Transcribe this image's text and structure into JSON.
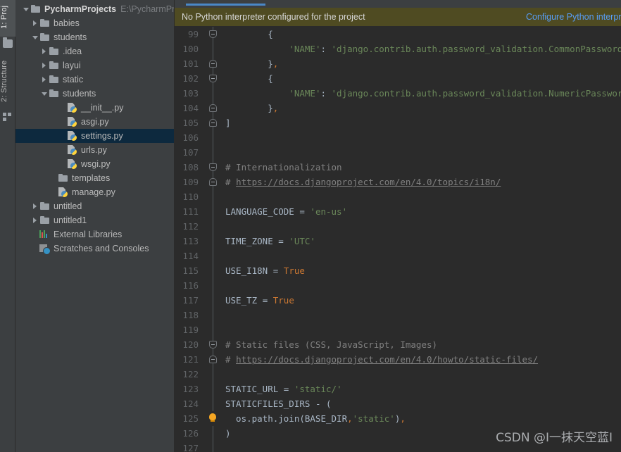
{
  "tool_strip": {
    "tabs": [
      {
        "label": "1: Proj",
        "name": "tool-tab-project",
        "active": true
      },
      {
        "label": "2: Structure",
        "name": "tool-tab-structure",
        "active": false
      }
    ]
  },
  "project_tree": {
    "root_label": "PycharmProjects",
    "root_path": "E:\\PycharmPro",
    "items": [
      {
        "label": "babies",
        "indent": 2,
        "arrow": "collapsed",
        "icon": "folder"
      },
      {
        "label": "students",
        "indent": 2,
        "arrow": "expanded",
        "icon": "folder"
      },
      {
        "label": ".idea",
        "indent": 3,
        "arrow": "collapsed",
        "icon": "folder"
      },
      {
        "label": "layui",
        "indent": 3,
        "arrow": "collapsed",
        "icon": "folder"
      },
      {
        "label": "static",
        "indent": 3,
        "arrow": "collapsed",
        "icon": "folder"
      },
      {
        "label": "students",
        "indent": 3,
        "arrow": "expanded",
        "icon": "folder"
      },
      {
        "label": "__init__.py",
        "indent": 5,
        "arrow": "none",
        "icon": "py"
      },
      {
        "label": "asgi.py",
        "indent": 5,
        "arrow": "none",
        "icon": "py"
      },
      {
        "label": "settings.py",
        "indent": 5,
        "arrow": "none",
        "icon": "py",
        "selected": true
      },
      {
        "label": "urls.py",
        "indent": 5,
        "arrow": "none",
        "icon": "py"
      },
      {
        "label": "wsgi.py",
        "indent": 5,
        "arrow": "none",
        "icon": "py"
      },
      {
        "label": "templates",
        "indent": 4,
        "arrow": "none",
        "icon": "folder"
      },
      {
        "label": "manage.py",
        "indent": 4,
        "arrow": "none",
        "icon": "py"
      },
      {
        "label": "untitled",
        "indent": 2,
        "arrow": "collapsed",
        "icon": "folder"
      },
      {
        "label": "untitled1",
        "indent": 2,
        "arrow": "collapsed",
        "icon": "folder"
      },
      {
        "label": "External Libraries",
        "indent": 2,
        "arrow": "none",
        "icon": "libs"
      },
      {
        "label": "Scratches and Consoles",
        "indent": 2,
        "arrow": "none",
        "icon": "scratch"
      }
    ]
  },
  "notification": {
    "message": "No Python interpreter configured for the project",
    "action_label": "Configure Python interpreter",
    "background": "#4f4b22",
    "link_color": "#589df6"
  },
  "editor": {
    "first_line": 99,
    "lines": [
      {
        "no": 99,
        "fold": "start",
        "tokens": [
          {
            "t": "        {",
            "c": "c-plain"
          }
        ]
      },
      {
        "no": 100,
        "fold": "bar",
        "tokens": [
          {
            "t": "            ",
            "c": "c-plain"
          },
          {
            "t": "'NAME'",
            "c": "c-str"
          },
          {
            "t": ": ",
            "c": "c-plain"
          },
          {
            "t": "'django.contrib.auth.password_validation.CommonPasswordValidator'",
            "c": "c-str"
          }
        ]
      },
      {
        "no": 101,
        "fold": "end",
        "tokens": [
          {
            "t": "        }",
            "c": "c-plain"
          },
          {
            "t": ",",
            "c": "c-comma"
          }
        ]
      },
      {
        "no": 102,
        "fold": "start",
        "tokens": [
          {
            "t": "        {",
            "c": "c-plain"
          }
        ]
      },
      {
        "no": 103,
        "fold": "bar",
        "tokens": [
          {
            "t": "            ",
            "c": "c-plain"
          },
          {
            "t": "'NAME'",
            "c": "c-str"
          },
          {
            "t": ": ",
            "c": "c-plain"
          },
          {
            "t": "'django.contrib.auth.password_validation.NumericPasswordValidator'",
            "c": "c-str"
          }
        ]
      },
      {
        "no": 104,
        "fold": "end",
        "tokens": [
          {
            "t": "        }",
            "c": "c-plain"
          },
          {
            "t": ",",
            "c": "c-comma"
          }
        ]
      },
      {
        "no": 105,
        "fold": "end",
        "tokens": [
          {
            "t": "]",
            "c": "c-plain"
          }
        ]
      },
      {
        "no": 106,
        "fold": "bar",
        "tokens": []
      },
      {
        "no": 107,
        "fold": "bar",
        "tokens": []
      },
      {
        "no": 108,
        "fold": "start",
        "tokens": [
          {
            "t": "# Internationalization",
            "c": "c-comment"
          }
        ]
      },
      {
        "no": 109,
        "fold": "end",
        "tokens": [
          {
            "t": "# ",
            "c": "c-comment"
          },
          {
            "t": "https://docs.djangoproject.com/en/4.0/topics/i18n/",
            "c": "c-link"
          }
        ]
      },
      {
        "no": 110,
        "fold": "bar",
        "tokens": []
      },
      {
        "no": 111,
        "fold": "bar",
        "tokens": [
          {
            "t": "LANGUAGE_CODE ",
            "c": "c-plain"
          },
          {
            "t": "= ",
            "c": "c-plain"
          },
          {
            "t": "'en-us'",
            "c": "c-str"
          }
        ]
      },
      {
        "no": 112,
        "fold": "bar",
        "tokens": []
      },
      {
        "no": 113,
        "fold": "bar",
        "tokens": [
          {
            "t": "TIME_ZONE ",
            "c": "c-plain"
          },
          {
            "t": "= ",
            "c": "c-plain"
          },
          {
            "t": "'UTC'",
            "c": "c-str"
          }
        ]
      },
      {
        "no": 114,
        "fold": "bar",
        "tokens": []
      },
      {
        "no": 115,
        "fold": "bar",
        "tokens": [
          {
            "t": "USE_I18N ",
            "c": "c-plain"
          },
          {
            "t": "= ",
            "c": "c-plain"
          },
          {
            "t": "True",
            "c": "c-kw"
          }
        ]
      },
      {
        "no": 116,
        "fold": "bar",
        "tokens": []
      },
      {
        "no": 117,
        "fold": "bar",
        "tokens": [
          {
            "t": "USE_TZ ",
            "c": "c-plain"
          },
          {
            "t": "= ",
            "c": "c-plain"
          },
          {
            "t": "True",
            "c": "c-kw"
          }
        ]
      },
      {
        "no": 118,
        "fold": "bar",
        "tokens": []
      },
      {
        "no": 119,
        "fold": "bar",
        "tokens": []
      },
      {
        "no": 120,
        "fold": "start",
        "tokens": [
          {
            "t": "# Static files (CSS, JavaScript, Images)",
            "c": "c-comment"
          }
        ]
      },
      {
        "no": 121,
        "fold": "end",
        "tokens": [
          {
            "t": "# ",
            "c": "c-comment"
          },
          {
            "t": "https://docs.djangoproject.com/en/4.0/howto/static-files/",
            "c": "c-link"
          }
        ]
      },
      {
        "no": 122,
        "fold": "bar",
        "tokens": []
      },
      {
        "no": 123,
        "fold": "bar",
        "tokens": [
          {
            "t": "STATIC_URL ",
            "c": "c-plain"
          },
          {
            "t": "= ",
            "c": "c-plain"
          },
          {
            "t": "'static/'",
            "c": "c-str"
          }
        ]
      },
      {
        "no": 124,
        "fold": "bar",
        "tokens": [
          {
            "t": "STATICFILES_DIRS ",
            "c": "c-plain"
          },
          {
            "t": "- ",
            "c": "c-plain"
          },
          {
            "t": "(",
            "c": "c-plain"
          }
        ]
      },
      {
        "no": 125,
        "fold": "bulb",
        "tokens": [
          {
            "t": "  os.path.join(BASE_DIR",
            "c": "c-plain"
          },
          {
            "t": ",",
            "c": "c-comma"
          },
          {
            "t": "'static'",
            "c": "c-str"
          },
          {
            "t": ")",
            "c": "c-plain"
          },
          {
            "t": ",",
            "c": "c-comma"
          }
        ]
      },
      {
        "no": 126,
        "fold": "bar",
        "tokens": [
          {
            "t": ")",
            "c": "c-plain"
          }
        ]
      },
      {
        "no": 127,
        "fold": "bar",
        "tokens": []
      }
    ]
  },
  "watermark": {
    "text": "CSDN @I一抹天空蓝I"
  }
}
